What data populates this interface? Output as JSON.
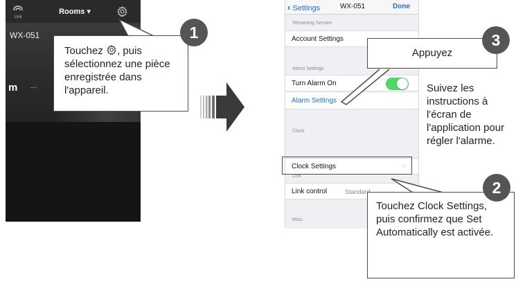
{
  "left_screen": {
    "link_label": "Link",
    "rooms_label": "Rooms ▾",
    "room_name": "WX-051",
    "room_logo": "m",
    "room_dash": "---"
  },
  "callout1": {
    "number": "1",
    "text_before_icon": "Touchez ",
    "text_after_icon": ", puis",
    "text_rest": "sélectionnez une pièce enregistrée dans l'appareil."
  },
  "right_screen": {
    "nav": {
      "back_label": "Settings",
      "title": "WX-051",
      "done_label": "Done"
    },
    "sections": {
      "streaming": "Streaming Service",
      "alarm": "Alarm Settings",
      "clock": "Clock",
      "link": "Link",
      "misc": "Misc."
    },
    "rows": {
      "account": "Account Settings",
      "turn_alarm": "Turn Alarm On",
      "alarm_settings": "Alarm Settings",
      "clock_settings": "Clock Settings",
      "link_control": "Link control",
      "link_control_value": "Standard"
    },
    "alarm_toggle_on": true
  },
  "callout3": {
    "number": "3",
    "text": "Appuyez"
  },
  "callout2": {
    "number": "2",
    "text": "Touchez Clock Settings, puis confirmez que Set Automatically est activée."
  },
  "side_instruction": "Suivez les instructions à l'écran de l'application pour régler l'alarme.",
  "colors": {
    "accent_blue": "#1a6fe0",
    "toggle_green": "#4cd964",
    "badge": "#555555"
  }
}
